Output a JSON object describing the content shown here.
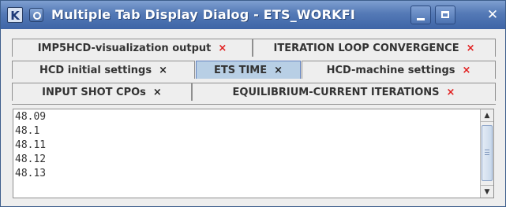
{
  "window": {
    "title": "Multiple Tab Display Dialog - ETS_WORKFI",
    "app_icon_letter": "K",
    "controls": {
      "minimize": "minimize",
      "maximize": "maximize",
      "close": "✕"
    }
  },
  "tabs": {
    "row1": [
      {
        "label": "IMP5HCD-visualization output",
        "close": "×",
        "close_color": "#e11d1d"
      },
      {
        "label": "ITERATION LOOP CONVERGENCE",
        "close": "×",
        "close_color": "#e11d1d"
      }
    ],
    "row2": [
      {
        "label": "HCD initial settings",
        "close": "×",
        "close_color": "#222222"
      },
      {
        "label": "ETS TIME",
        "close": "×",
        "close_color": "#222222",
        "selected": true
      },
      {
        "label": "HCD-machine settings",
        "close": "×",
        "close_color": "#e11d1d"
      }
    ],
    "row3": [
      {
        "label": "INPUT SHOT CPOs",
        "close": "×",
        "close_color": "#222222"
      },
      {
        "label": "EQUILIBRIUM-CURRENT ITERATIONS",
        "close": "×",
        "close_color": "#e11d1d"
      }
    ]
  },
  "content": {
    "lines": [
      "48.09",
      "48.1",
      "48.11",
      "48.12",
      "48.13"
    ]
  },
  "scrollbar": {
    "up_arrow": "▲",
    "down_arrow": "▼"
  },
  "colors": {
    "titlebar": "#4f73b0",
    "selected_tab": "#b8cfe5",
    "close_red": "#e11d1d"
  }
}
